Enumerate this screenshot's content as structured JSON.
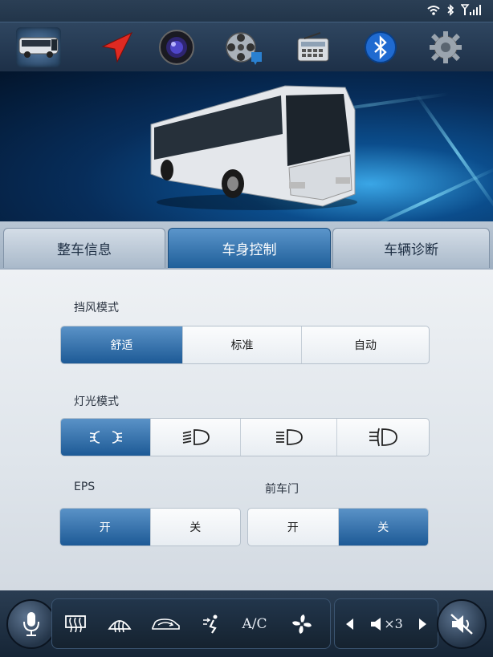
{
  "tabs": [
    "整车信息",
    "车身控制",
    "车辆诊断"
  ],
  "windshield": {
    "label": "挡风模式",
    "options": [
      "舒适",
      "标准",
      "自动"
    ],
    "selected": "舒适"
  },
  "lights": {
    "label": "灯光模式",
    "options": [
      "parking-lights-icon",
      "low-beam-icon",
      "high-beam-icon",
      "fog-light-icon"
    ],
    "selected": "parking-lights-icon"
  },
  "eps": {
    "label": "EPS",
    "options": [
      "开",
      "关"
    ],
    "selected": "开"
  },
  "front_door": {
    "label": "前车门",
    "options": [
      "开",
      "关"
    ],
    "selected": "关"
  },
  "bottom": {
    "ac_label": "A/C",
    "volume_label": "×3"
  }
}
